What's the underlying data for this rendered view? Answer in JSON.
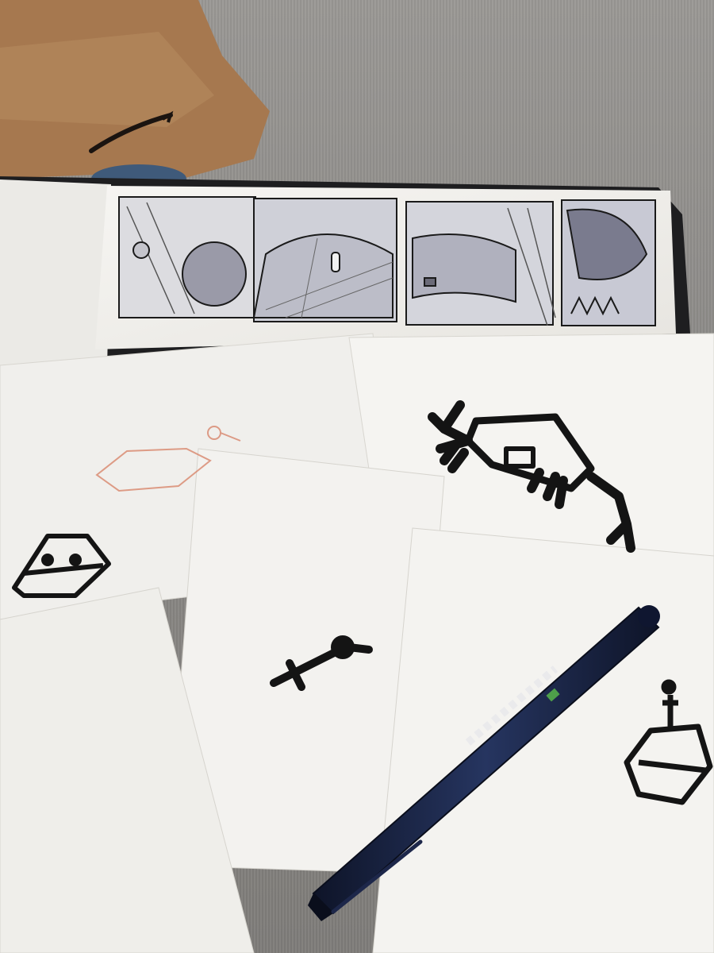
{
  "scene": {
    "description_free": true,
    "colors": {
      "carpet": "#8c8a87",
      "cardboard": "#a6784f",
      "paper": "#f2f1ee",
      "ink": "#141414",
      "pen_body": "#16203d",
      "sketch_red": "#d8866c",
      "game_art_red": "#c8312c",
      "game_art_blue": "#2a4fa0",
      "game_art_yellow": "#f1c23b"
    },
    "objects": [
      {
        "name": "cardboard-box",
        "icon": "box-icon"
      },
      {
        "name": "sketchbook",
        "icon": "sketchbook-icon"
      },
      {
        "name": "comic-strip",
        "panels": 4
      },
      {
        "name": "paper-cutout",
        "icon": "crab-robot-icon"
      },
      {
        "name": "paper-cutout",
        "icon": "hex-chest-icon"
      },
      {
        "name": "paper-cutout",
        "icon": "key-icon"
      },
      {
        "name": "paper-cutout",
        "icon": "hex-beacon-icon"
      },
      {
        "name": "brush-pen",
        "icon": "pen-icon"
      }
    ]
  }
}
